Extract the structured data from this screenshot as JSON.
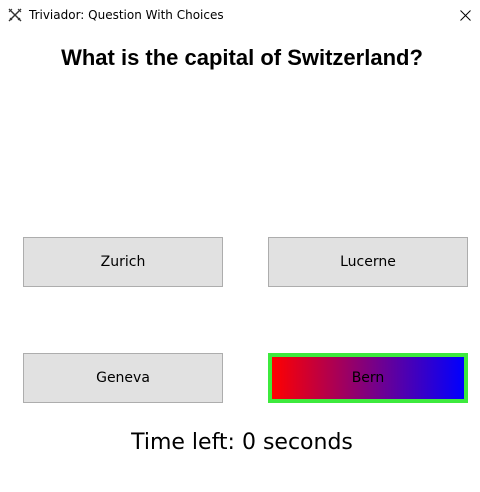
{
  "window": {
    "title": "Triviador: Question With Choices",
    "app_icon": "crossed-swords-icon",
    "close_icon": "close-icon"
  },
  "question": {
    "text": "What is the capital of Switzerland?"
  },
  "choices": [
    {
      "label": "Zurich",
      "selected": false
    },
    {
      "label": "Lucerne",
      "selected": false
    },
    {
      "label": "Geneva",
      "selected": false
    },
    {
      "label": "Bern",
      "selected": true
    }
  ],
  "selected_style": {
    "border_color": "#3dea3d",
    "gradient_start": "#ff0000",
    "gradient_end": "#0000ff"
  },
  "timer": {
    "text": "Time left: 0 seconds"
  }
}
